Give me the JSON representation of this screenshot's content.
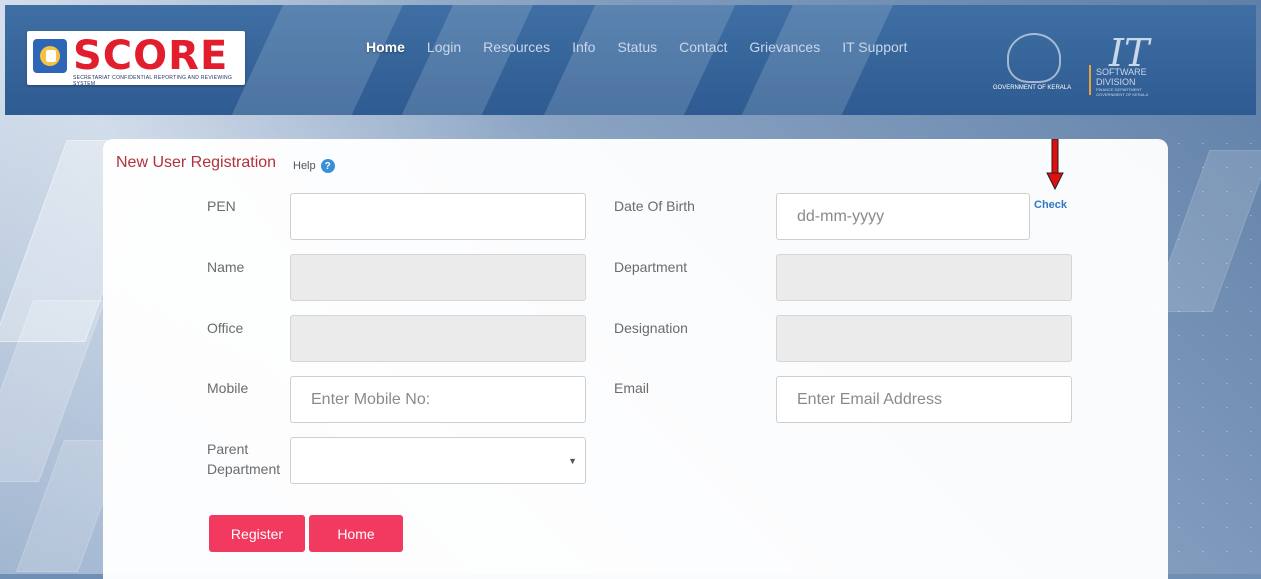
{
  "header": {
    "logo_text": "SCORE",
    "logo_tagline": "SECRETARIAT CONFIDENTIAL REPORTING AND REVIEWING SYSTEM",
    "nav": [
      "Home",
      "Login",
      "Resources",
      "Info",
      "Status",
      "Contact",
      "Grievances",
      "IT Support"
    ],
    "gov_label": "GOVERNMENT OF KERALA",
    "it_mark": "IT",
    "it_label_line1": "SOFTWARE",
    "it_label_line2": "DIVISION",
    "it_label_sub": "FINANCE DEPARTMENT GOVERNMENT OF KERALA"
  },
  "form": {
    "title": "New User Registration",
    "help_label": "Help",
    "help_icon": "?",
    "labels": {
      "pen": "PEN",
      "name": "Name",
      "office": "Office",
      "mobile": "Mobile",
      "parent_line1": "Parent",
      "parent_line2": "Department",
      "dob": "Date Of Birth",
      "department": "Department",
      "designation": "Designation",
      "email": "Email"
    },
    "placeholders": {
      "dob": "dd-mm-yyyy",
      "mobile": "Enter Mobile No:",
      "email": "Enter Email Address"
    },
    "check_label": "Check",
    "buttons": {
      "register": "Register",
      "home": "Home"
    }
  },
  "colors": {
    "accent": "#f2395f",
    "title": "#b0323b",
    "link": "#2f78c4",
    "arrow": "#e01010"
  }
}
